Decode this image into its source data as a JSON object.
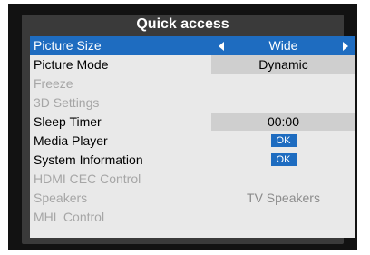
{
  "title": "Quick access",
  "items": [
    {
      "label": "Picture Size",
      "value": "Wide"
    },
    {
      "label": "Picture Mode",
      "value": "Dynamic"
    },
    {
      "label": "Freeze",
      "value": ""
    },
    {
      "label": "3D Settings",
      "value": ""
    },
    {
      "label": "Sleep Timer",
      "value": "00:00"
    },
    {
      "label": "Media Player",
      "value": "OK"
    },
    {
      "label": "System Information",
      "value": "OK"
    },
    {
      "label": "HDMI CEC Control",
      "value": ""
    },
    {
      "label": "Speakers",
      "value": "TV Speakers"
    },
    {
      "label": "MHL Control",
      "value": ""
    }
  ],
  "colors": {
    "selection": "#1e6cc0",
    "panel": "#3a3a3a",
    "menu_bg": "#e9e9e9"
  }
}
